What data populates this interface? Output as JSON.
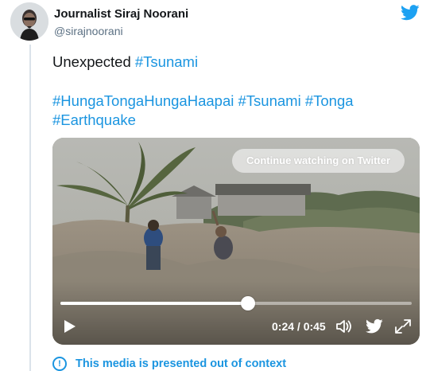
{
  "author": {
    "display_name": "Journalist Siraj Noorani",
    "handle": "@sirajnoorani",
    "avatar_icon": "profile-photo"
  },
  "brand_icon": "twitter-bird-icon",
  "tweet": {
    "line1_text": "Unexpected ",
    "line1_hashtag": "#Tsunami",
    "line2_hashtags": [
      "#HungaTongaHungaHaapai",
      "#Tsunami",
      "#Tonga"
    ],
    "line3_hashtag": "#Earthquake"
  },
  "video": {
    "continue_label": "Continue watching on Twitter",
    "current_time": "0:24",
    "duration": "0:45",
    "time_display": "0:24 / 0:45",
    "progress_fraction": 0.533
  },
  "context_label": "This media is presented out of context",
  "colors": {
    "link": "#1b95e0",
    "text": "#14171a",
    "muted": "#5b7083"
  }
}
